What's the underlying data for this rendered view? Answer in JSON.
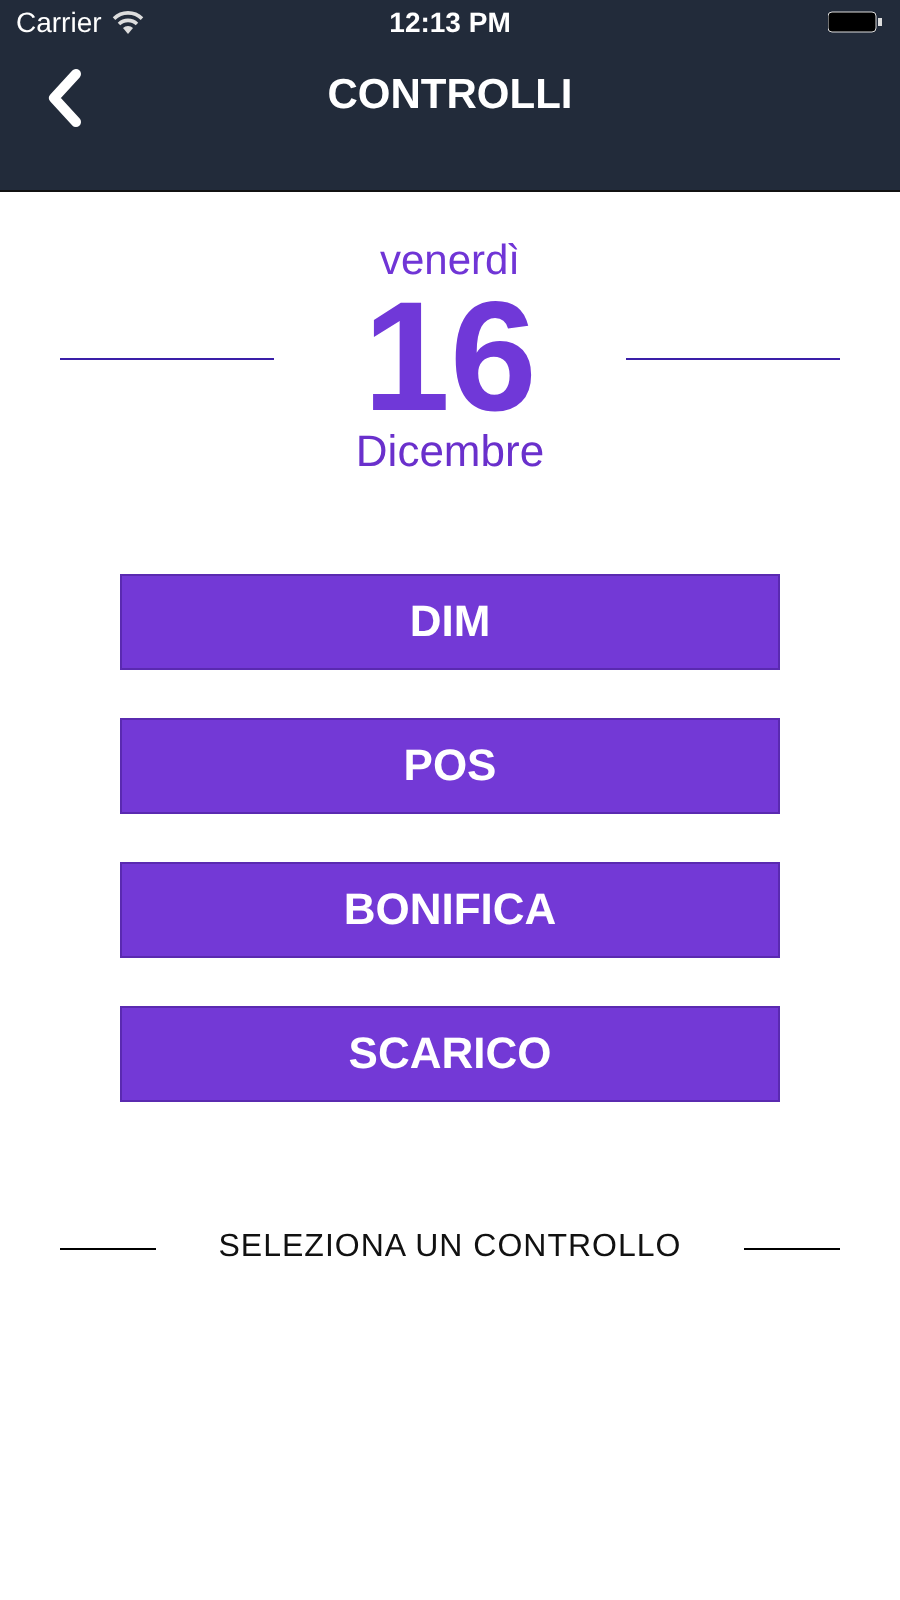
{
  "status_bar": {
    "carrier": "Carrier",
    "time": "12:13 PM"
  },
  "nav": {
    "title": "CONTROLLI"
  },
  "date": {
    "weekday": "venerdì",
    "day": "16",
    "month": "Dicembre"
  },
  "buttons": [
    "DIM",
    "POS",
    "BONIFICA",
    "SCARICO"
  ],
  "footer": {
    "label": "SELEZIONA UN CONTROLLO"
  }
}
